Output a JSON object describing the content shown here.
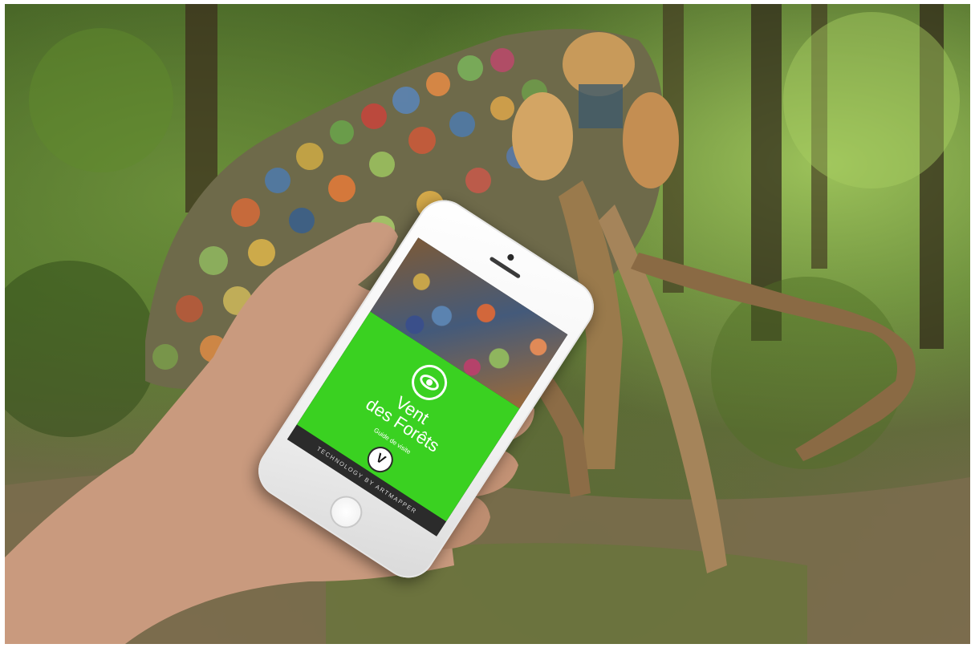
{
  "photo": {
    "subject": "hand holding smartphone in forest in front of mammoth sculpture"
  },
  "app_screen": {
    "title": "Vent\ndes Forêts",
    "subtitle": "Guide de visite",
    "logo_letter": "V",
    "footer": "TECHNOLOGY BY ARTMAPPER",
    "accent_color": "#3ad121",
    "icon": "eye-icon"
  }
}
